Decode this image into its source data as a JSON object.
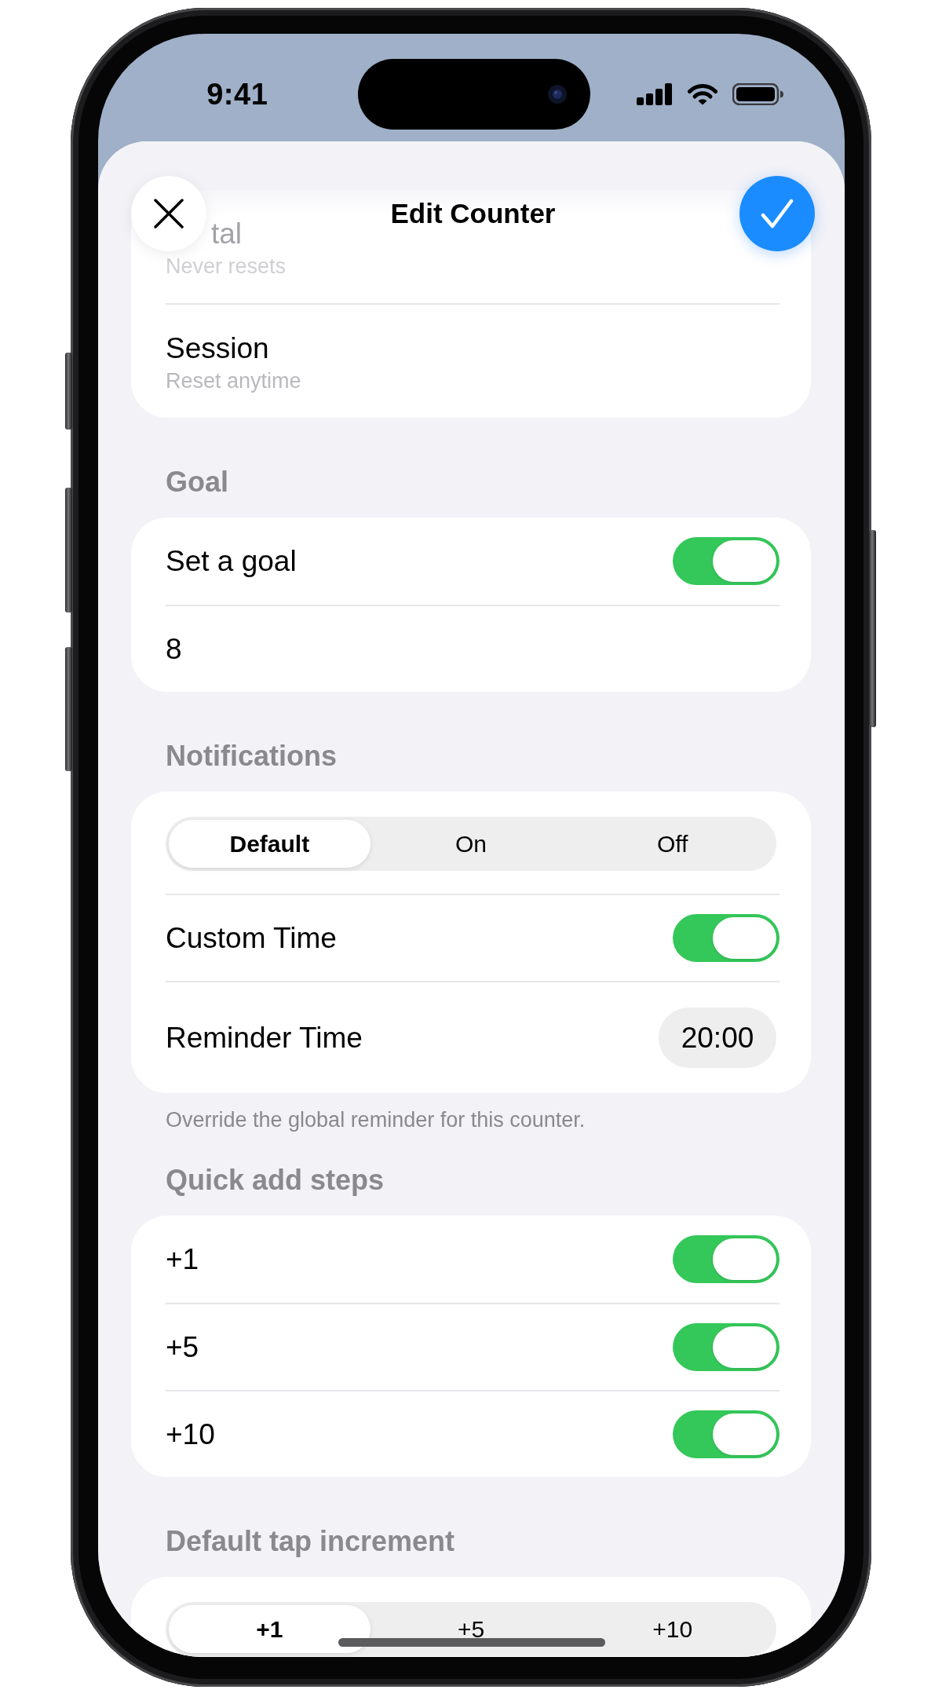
{
  "status_bar": {
    "time": "9:41"
  },
  "header": {
    "title": "Edit Counter"
  },
  "sections": [
    {
      "rows": [
        {
          "kind": "faded",
          "title": "tal",
          "subtitle": "Never resets"
        },
        {
          "kind": "subtitle",
          "title": "Session",
          "subtitle": "Reset anytime"
        }
      ]
    },
    {
      "header": "Goal",
      "rows": [
        {
          "kind": "toggle",
          "label": "Set a goal",
          "on": true
        },
        {
          "kind": "field",
          "value": "8"
        }
      ]
    },
    {
      "header": "Notifications",
      "rows": [
        {
          "kind": "segmented",
          "options": [
            {
              "label": "Default",
              "selected": true
            },
            {
              "label": "On",
              "selected": false
            },
            {
              "label": "Off",
              "selected": false
            }
          ]
        },
        {
          "kind": "toggle",
          "label": "Custom Time",
          "on": true
        },
        {
          "kind": "time",
          "label": "Reminder Time",
          "value": "20:00"
        }
      ],
      "footer": "Override the global reminder for this counter."
    },
    {
      "header": "Quick add steps",
      "rows": [
        {
          "kind": "toggle",
          "label": "+1",
          "on": true
        },
        {
          "kind": "toggle",
          "label": "+5",
          "on": true
        },
        {
          "kind": "toggle",
          "label": "+10",
          "on": true
        }
      ]
    },
    {
      "header": "Default tap increment",
      "rows": [
        {
          "kind": "segmented",
          "options": [
            {
              "label": "+1",
              "selected": true
            },
            {
              "label": "+5",
              "selected": false
            },
            {
              "label": "+10",
              "selected": false
            }
          ]
        }
      ]
    }
  ]
}
